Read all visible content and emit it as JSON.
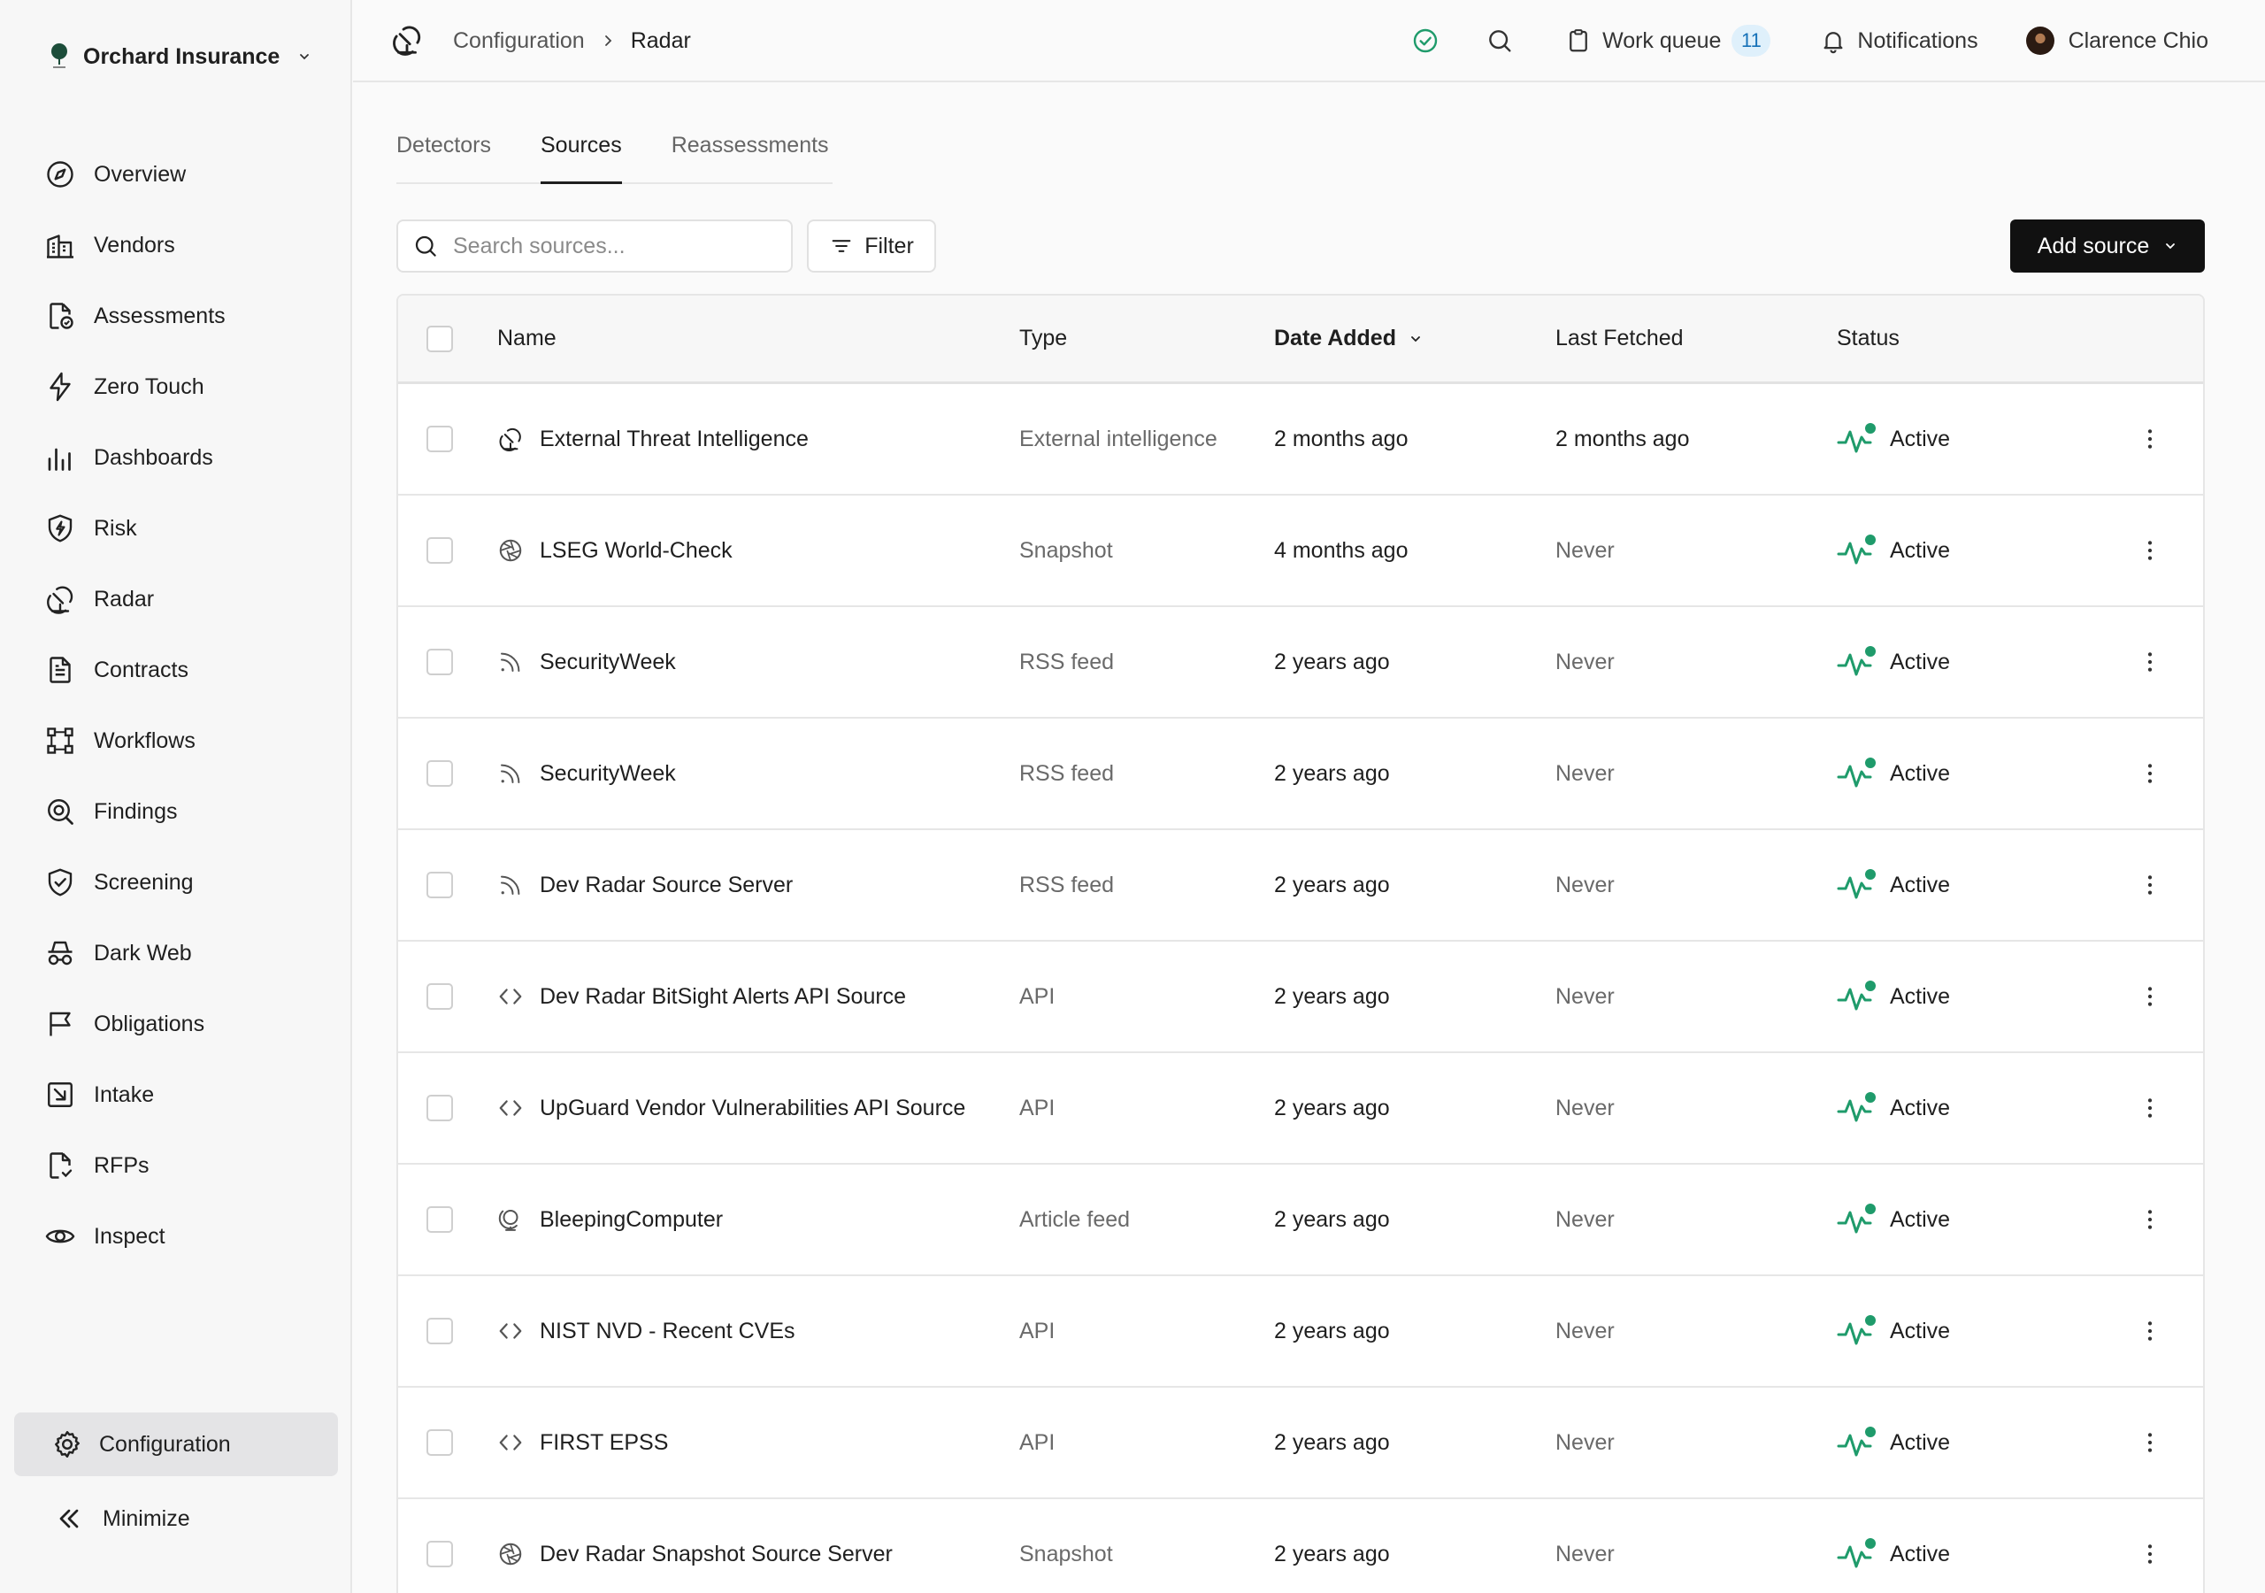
{
  "org": {
    "name": "Orchard Insurance"
  },
  "nav": [
    {
      "label": "Overview",
      "icon": "compass-icon"
    },
    {
      "label": "Vendors",
      "icon": "building-icon"
    },
    {
      "label": "Assessments",
      "icon": "file-check-icon"
    },
    {
      "label": "Zero Touch",
      "icon": "bolt-icon"
    },
    {
      "label": "Dashboards",
      "icon": "bar-chart-icon"
    },
    {
      "label": "Risk",
      "icon": "shield-bolt-icon"
    },
    {
      "label": "Radar",
      "icon": "radar-icon"
    },
    {
      "label": "Contracts",
      "icon": "document-icon"
    },
    {
      "label": "Workflows",
      "icon": "workflow-icon"
    },
    {
      "label": "Findings",
      "icon": "search-target-icon"
    },
    {
      "label": "Screening",
      "icon": "shield-check-icon"
    },
    {
      "label": "Dark Web",
      "icon": "incognito-icon"
    },
    {
      "label": "Obligations",
      "icon": "flag-icon"
    },
    {
      "label": "Intake",
      "icon": "inbox-arrow-icon"
    },
    {
      "label": "RFPs",
      "icon": "file-arrow-icon"
    },
    {
      "label": "Inspect",
      "icon": "eye-icon"
    }
  ],
  "sidebar_footer": {
    "configuration": "Configuration",
    "minimize": "Minimize"
  },
  "breadcrumb": {
    "parent": "Configuration",
    "current": "Radar"
  },
  "topbar": {
    "work_queue_label": "Work queue",
    "work_queue_count": "11",
    "notifications_label": "Notifications",
    "user_name": "Clarence Chio"
  },
  "tabs": [
    {
      "label": "Detectors",
      "active": false
    },
    {
      "label": "Sources",
      "active": true
    },
    {
      "label": "Reassessments",
      "active": false
    }
  ],
  "search": {
    "placeholder": "Search sources..."
  },
  "filter_label": "Filter",
  "add_source_label": "Add source",
  "table": {
    "columns": {
      "name": "Name",
      "type": "Type",
      "date_added": "Date Added",
      "last_fetched": "Last Fetched",
      "status": "Status"
    },
    "sort": {
      "column": "date_added",
      "direction": "desc"
    },
    "rows": [
      {
        "icon": "radar-icon",
        "name": "External Threat Intelligence",
        "type": "External intelligence",
        "date_added": "2 months ago",
        "last_fetched": "2 months ago",
        "status": "Active",
        "last_fetched_emph": true
      },
      {
        "icon": "aperture-icon",
        "name": "LSEG World-Check",
        "type": "Snapshot",
        "date_added": "4 months ago",
        "last_fetched": "Never",
        "status": "Active"
      },
      {
        "icon": "rss-icon",
        "name": "SecurityWeek",
        "type": "RSS feed",
        "date_added": "2 years ago",
        "last_fetched": "Never",
        "status": "Active"
      },
      {
        "icon": "rss-icon",
        "name": "SecurityWeek",
        "type": "RSS feed",
        "date_added": "2 years ago",
        "last_fetched": "Never",
        "status": "Active"
      },
      {
        "icon": "rss-icon",
        "name": "Dev Radar Source Server",
        "type": "RSS feed",
        "date_added": "2 years ago",
        "last_fetched": "Never",
        "status": "Active"
      },
      {
        "icon": "code-icon",
        "name": "Dev Radar BitSight Alerts API Source",
        "type": "API",
        "date_added": "2 years ago",
        "last_fetched": "Never",
        "status": "Active"
      },
      {
        "icon": "code-icon",
        "name": "UpGuard Vendor Vulnerabilities API Source",
        "type": "API",
        "date_added": "2 years ago",
        "last_fetched": "Never",
        "status": "Active"
      },
      {
        "icon": "globe-stand-icon",
        "name": "BleepingComputer",
        "type": "Article feed",
        "date_added": "2 years ago",
        "last_fetched": "Never",
        "status": "Active"
      },
      {
        "icon": "code-icon",
        "name": "NIST NVD - Recent CVEs",
        "type": "API",
        "date_added": "2 years ago",
        "last_fetched": "Never",
        "status": "Active"
      },
      {
        "icon": "code-icon",
        "name": "FIRST EPSS",
        "type": "API",
        "date_added": "2 years ago",
        "last_fetched": "Never",
        "status": "Active"
      },
      {
        "icon": "aperture-icon",
        "name": "Dev Radar Snapshot Source Server",
        "type": "Snapshot",
        "date_added": "2 years ago",
        "last_fetched": "Never",
        "status": "Active"
      }
    ]
  },
  "colors": {
    "accent_green": "#1f9b6b",
    "badge_bg": "#dff0fb",
    "badge_text": "#1671b8",
    "primary_button": "#111111"
  }
}
